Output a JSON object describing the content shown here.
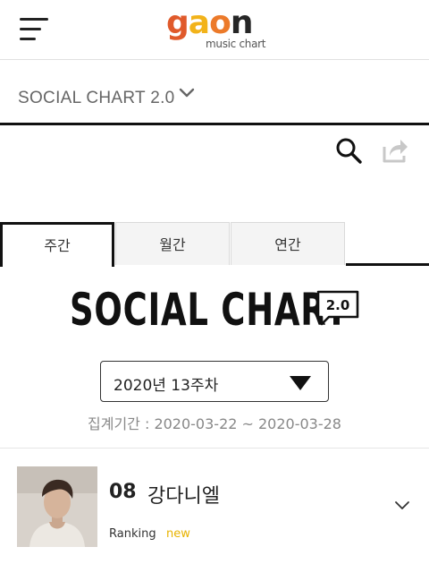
{
  "header": {
    "logo_text": "gaon",
    "logo_sub": "music chart",
    "colors": {
      "g": "#e05a2b",
      "a": "#f2b31a",
      "o": "#ec7a2a",
      "n": "#262626"
    }
  },
  "subnav": {
    "title": "SOCIAL CHART 2.0"
  },
  "tabs": [
    {
      "label": "주간",
      "active": true
    },
    {
      "label": "월간",
      "active": false
    },
    {
      "label": "연간",
      "active": false
    }
  ],
  "chart_logo": {
    "text": "SOCIAL CHART",
    "badge": "2.0"
  },
  "week_select": {
    "value": "2020년 13주차"
  },
  "period": {
    "text": "집계기간 : 2020-03-22 ~ 2020-03-28"
  },
  "entry": {
    "rank": "08",
    "artist": "강다니엘",
    "ranking_label": "Ranking",
    "status": "new"
  },
  "icons": [
    "menu-icon",
    "chevron-down-icon",
    "search-icon",
    "share-icon",
    "dropdown-caret-icon",
    "speech-bubble-icon"
  ]
}
